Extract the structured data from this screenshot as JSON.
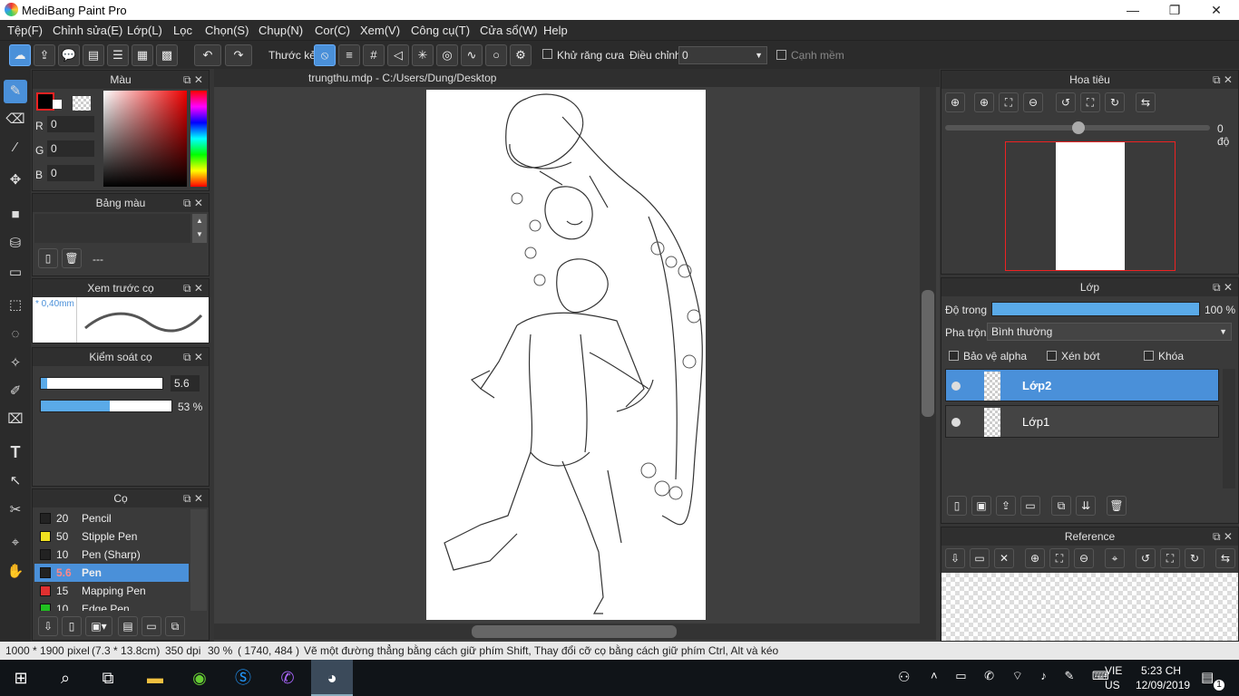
{
  "window": {
    "title": "MediBang Paint Pro",
    "min": "—",
    "max": "❐",
    "close": "✕"
  },
  "menu": [
    "Tệp(F)",
    "Chỉnh sửa(E)",
    "Lớp(L)",
    "Lọc",
    "Chọn(S)",
    "Chụp(N)",
    "Cor(C)",
    "Xem(V)",
    "Công cụ(T)",
    "Cửa sổ(W)",
    "Help"
  ],
  "toolbar": {
    "ruler_label": "Thước kẻ",
    "antialias_label": "Khử răng cưa",
    "correction_label": "Điều chỉnh",
    "correction_value": "0",
    "soft_edge_label": "Cạnh mềm"
  },
  "color_panel": {
    "title": "Màu",
    "r_label": "R",
    "g_label": "G",
    "b_label": "B",
    "r": "0",
    "g": "0",
    "b": "0"
  },
  "palette_panel": {
    "title": "Bảng màu",
    "value": "---"
  },
  "brush_preview": {
    "title": "Xem trước cọ",
    "size": "* 0,40mm"
  },
  "brush_control": {
    "title": "Kiểm soát cọ",
    "size_value": "5.6",
    "size_fraction": 0.05,
    "opacity_value": "53 %",
    "opacity_fraction": 0.53
  },
  "brush_panel": {
    "title": "Cọ",
    "items": [
      {
        "size": "20",
        "name": "Pencil",
        "color": "#222222"
      },
      {
        "size": "50",
        "name": "Stipple Pen",
        "color": "#f0e020"
      },
      {
        "size": "10",
        "name": "Pen (Sharp)",
        "color": "#222222"
      },
      {
        "size": "5.6",
        "name": "Pen",
        "color": "#222222",
        "selected": true
      },
      {
        "size": "15",
        "name": "Mapping Pen",
        "color": "#e03030"
      },
      {
        "size": "10",
        "name": "Edge Pen",
        "color": "#20c020"
      }
    ]
  },
  "document": {
    "tab": "trungthu.mdp - C:/Users/Dung/Desktop"
  },
  "navigator": {
    "title": "Hoa tiêu",
    "rotation": "0 độ"
  },
  "layer_panel": {
    "title": "Lớp",
    "opacity_label": "Độ trong",
    "opacity_value": "100 %",
    "opacity_fraction": 1.0,
    "blend_label": "Pha trộn",
    "blend_value": "Bình thường",
    "protect_alpha": "Bảo vệ alpha",
    "clipping": "Xén bớt",
    "lock": "Khóa",
    "layers": [
      {
        "name": "Lớp2",
        "selected": true
      },
      {
        "name": "Lớp1",
        "selected": false
      }
    ]
  },
  "reference_panel": {
    "title": "Reference"
  },
  "status": {
    "size": "1000 * 1900 pixel",
    "cm": "(7.3 * 13.8cm)",
    "dpi": "350 dpi",
    "zoom": "30 %",
    "coords": "( 1740, 484 )",
    "hint": "Vẽ một đường thẳng bằng cách giữ phím Shift, Thay đổi cỡ cọ bằng cách giữ phím Ctrl, Alt và kéo"
  },
  "taskbar": {
    "lang1": "VIE",
    "lang2": "US",
    "time": "5:23 CH",
    "date": "12/09/2019",
    "notif": "1"
  },
  "colors": {
    "accent": "#4a90d9",
    "panel": "#3a3a3a",
    "dark": "#2b2b2b"
  }
}
